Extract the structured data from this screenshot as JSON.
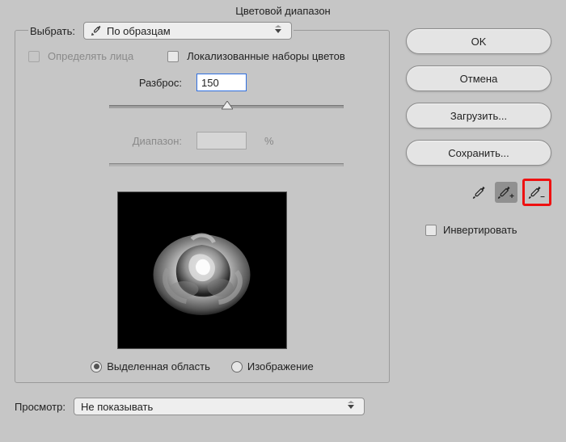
{
  "title": "Цветовой диапазон",
  "select": {
    "label": "Выбрать:",
    "value": "По образцам"
  },
  "detectFaces": {
    "label": "Определять лица"
  },
  "localized": {
    "label": "Локализованные наборы цветов"
  },
  "fuzziness": {
    "label": "Разброс:",
    "value": "150"
  },
  "range": {
    "label": "Диапазон:",
    "pct": "%"
  },
  "radio": {
    "selection": "Выделенная область",
    "image": "Изображение"
  },
  "previewMode": {
    "label": "Просмотр:",
    "value": "Не показывать"
  },
  "buttons": {
    "ok": "OK",
    "cancel": "Отмена",
    "load": "Загрузить...",
    "save": "Сохранить..."
  },
  "invert": {
    "label": "Инвертировать"
  }
}
